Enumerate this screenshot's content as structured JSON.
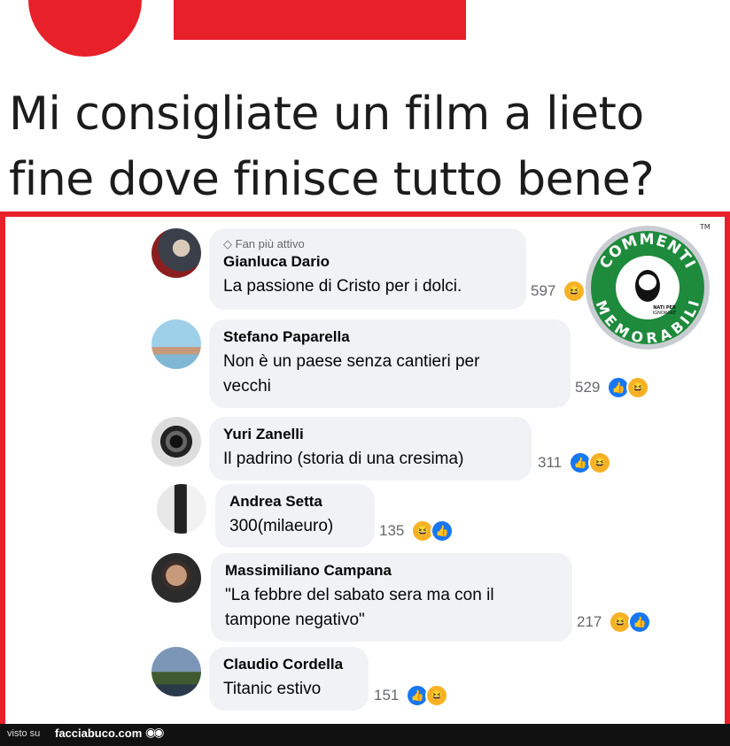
{
  "headline": {
    "line1": "Mi consigliate un film a lieto",
    "line2": "fine dove finisce tutto bene?"
  },
  "logo": {
    "top_text": "COMMENTI",
    "bottom_text": "MEMORABILI",
    "inner_text_1": "NATI PER",
    "inner_text_2": "IGNORARE",
    "tm": "TM",
    "colors": {
      "green": "#1e8a3c",
      "ring": "#c9cdd2"
    }
  },
  "comments": [
    {
      "badge": "Fan più attivo",
      "name": "Gianluca Dario",
      "lines": [
        "La passione di Cristo per i dolci."
      ],
      "count": "597",
      "reactions": [
        "haha"
      ]
    },
    {
      "badge": "",
      "name": "Stefano Paparella",
      "lines": [
        "Non è un paese senza cantieri per",
        "vecchi"
      ],
      "count": "529",
      "reactions": [
        "like",
        "haha"
      ]
    },
    {
      "badge": "",
      "name": "Yuri Zanelli",
      "lines": [
        "Il padrino (storia di una cresima)"
      ],
      "count": "311",
      "reactions": [
        "like",
        "haha"
      ]
    },
    {
      "badge": "",
      "name": "Andrea Setta",
      "lines": [
        "300(milaeuro)"
      ],
      "count": "135",
      "reactions": [
        "haha",
        "like"
      ]
    },
    {
      "badge": "",
      "name": "Massimiliano Campana",
      "lines": [
        "\"La febbre del sabato sera ma con il",
        "tampone negativo\""
      ],
      "count": "217",
      "reactions": [
        "haha",
        "like"
      ]
    },
    {
      "badge": "",
      "name": "Claudio Cordella",
      "lines": [
        "Titanic estivo"
      ],
      "count": "151",
      "reactions": [
        "like",
        "haha"
      ]
    }
  ],
  "footer": {
    "visto": "visto su",
    "site": "facciabuco.com"
  },
  "colors": {
    "accent": "#e8202a",
    "bubble": "#f0f2f5",
    "like": "#1877f2",
    "haha": "#f7b125"
  }
}
